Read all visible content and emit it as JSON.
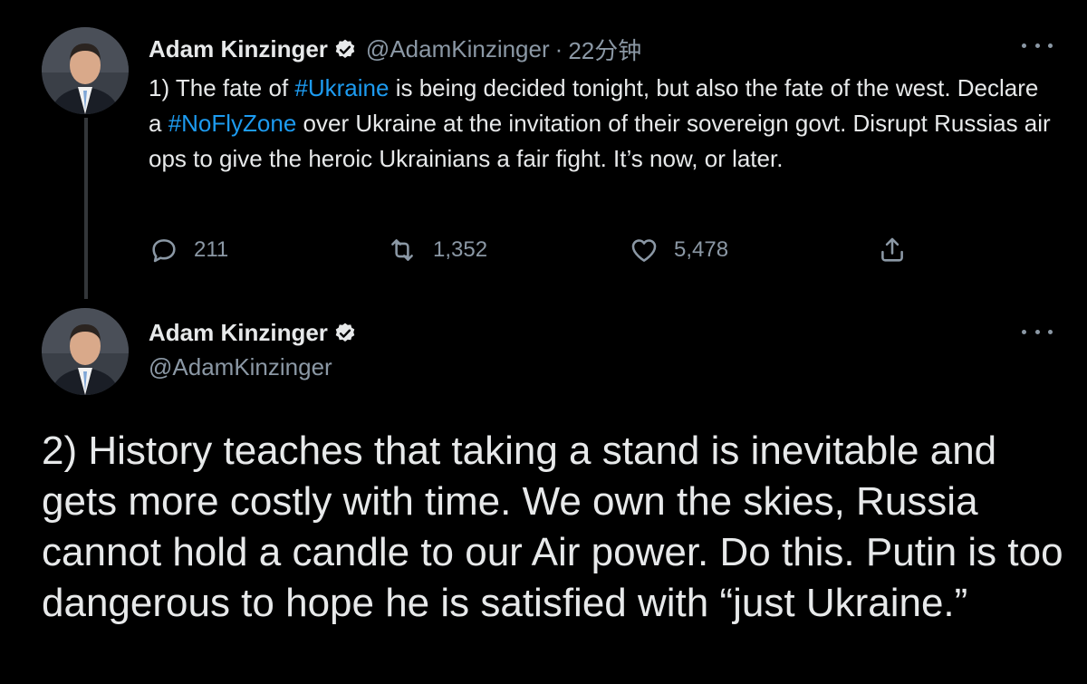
{
  "tweet1": {
    "author": {
      "display_name": "Adam Kinzinger",
      "handle": "@AdamKinzinger",
      "verified_icon": "verified-badge-icon"
    },
    "separator": "·",
    "timestamp": "22分钟",
    "text_parts": {
      "p1": "1) The fate of ",
      "h1": "#Ukraine",
      "p2": " is being decided tonight, but also the fate of the west. Declare a ",
      "h2": "#NoFlyZone",
      "p3": " over Ukraine at the invitation of their sovereign govt. Disrupt Russias air ops to give the heroic Ukrainians a fair fight.  It’s now, or later."
    },
    "actions": {
      "reply_count": "211",
      "retweet_count": "1,352",
      "like_count": "5,478"
    }
  },
  "tweet2": {
    "author": {
      "display_name": "Adam Kinzinger",
      "handle": "@AdamKinzinger",
      "verified_icon": "verified-badge-icon"
    },
    "text": "2) History teaches that taking a stand is inevitable and gets more costly with time.  We own the skies, Russia cannot hold a candle to our Air power.  Do this.  Putin is too dangerous to hope he is satisfied with “just Ukraine.”"
  },
  "colors": {
    "background": "#000000",
    "text": "#e7e9ea",
    "muted": "#8b98a5",
    "link": "#1d9bf0",
    "thread_line": "#333639"
  }
}
